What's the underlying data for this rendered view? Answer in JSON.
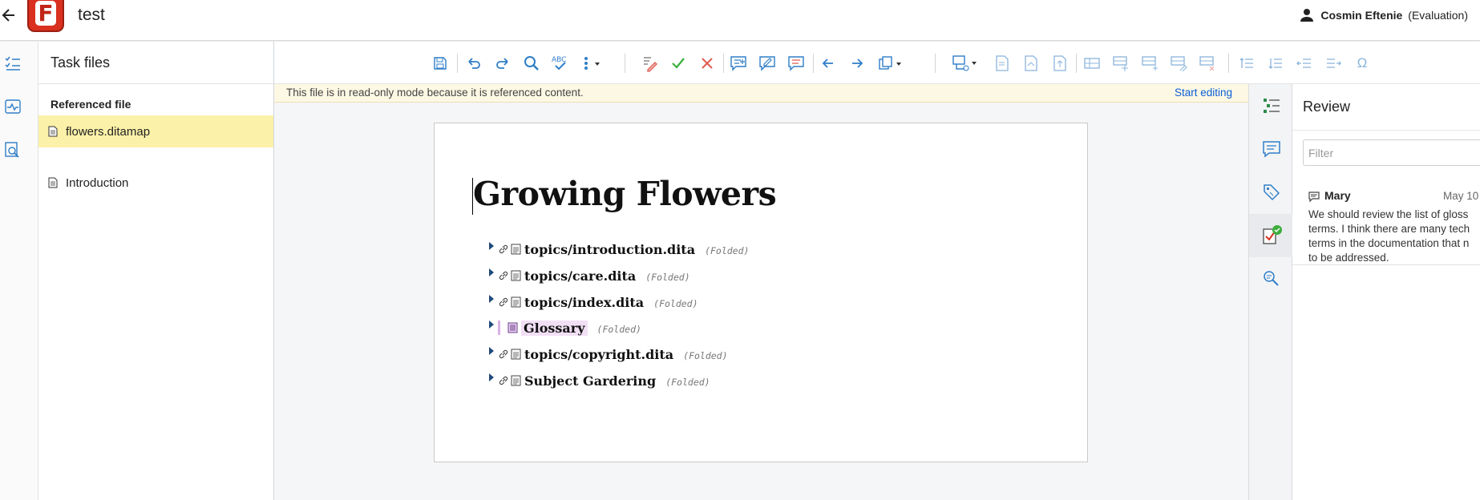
{
  "app": {
    "title": "test",
    "logo_letter": "F",
    "user_name": "Cosmin Eftenie",
    "user_plan": "(Evaluation)"
  },
  "left_rail": {
    "icons": [
      "task-list-icon",
      "activity-icon",
      "find-icon"
    ]
  },
  "panel": {
    "title": "Task files",
    "section_label": "Referenced file",
    "files": [
      {
        "label": "flowers.ditamap",
        "selected": true
      },
      {
        "label": "Introduction",
        "selected": false
      }
    ]
  },
  "toolbar": {
    "icons": [
      "save-icon",
      "undo-icon",
      "redo-icon",
      "search-icon",
      "spellcheck-icon",
      "more-options-icon",
      "track-changes-icon",
      "accept-change-icon",
      "reject-change-icon",
      "add-comment-icon",
      "edit-comment-icon",
      "remove-comment-icon",
      "previous-icon",
      "next-icon",
      "copy-paste-icon",
      "insert-reference-icon",
      "insert-topicref-icon",
      "insert-before-icon",
      "insert-after-icon",
      "insert-row-icon",
      "insert-table-icon",
      "insert-row-below-icon",
      "edit-properties-icon",
      "delete-row-icon",
      "move-up-icon",
      "move-down-icon",
      "promote-icon",
      "demote-icon",
      "special-char-icon"
    ],
    "special_char_glyph": "Ω"
  },
  "notice": {
    "text": "This file is in read-only mode because it is referenced content.",
    "action": "Start editing"
  },
  "document": {
    "title": "Growing Flowers",
    "topics": [
      {
        "label": "topics/introduction.dita",
        "status": "(Folded)",
        "kind": "link"
      },
      {
        "label": "topics/care.dita",
        "status": "(Folded)",
        "kind": "link"
      },
      {
        "label": "topics/index.dita",
        "status": "(Folded)",
        "kind": "link"
      },
      {
        "label": "Glossary",
        "status": "(Folded)",
        "kind": "glossary"
      },
      {
        "label": "topics/copyright.dita",
        "status": "(Folded)",
        "kind": "link"
      },
      {
        "label": "Subject Gardering",
        "status": "(Folded)",
        "kind": "link"
      }
    ]
  },
  "right_rail": {
    "items": [
      "outline-icon",
      "comments-icon",
      "tags-icon",
      "review-check-icon",
      "search-results-icon"
    ]
  },
  "review": {
    "title": "Review",
    "filter_placeholder": "Filter",
    "comments": [
      {
        "author": "Mary",
        "date": "May 10",
        "lines": [
          "We should review the list of gloss",
          "terms. I think there are many tech",
          "terms in the documentation that n",
          "to be addressed."
        ]
      }
    ]
  },
  "colors": {
    "accent": "#0b5fd6",
    "logo_red": "#d9301f",
    "selected_row": "#fbf1a8",
    "notice_bg": "#fdf8e4",
    "icon_blue": "#2f7ec8",
    "accept_green": "#3cae3c",
    "reject_red": "#e05a50"
  }
}
